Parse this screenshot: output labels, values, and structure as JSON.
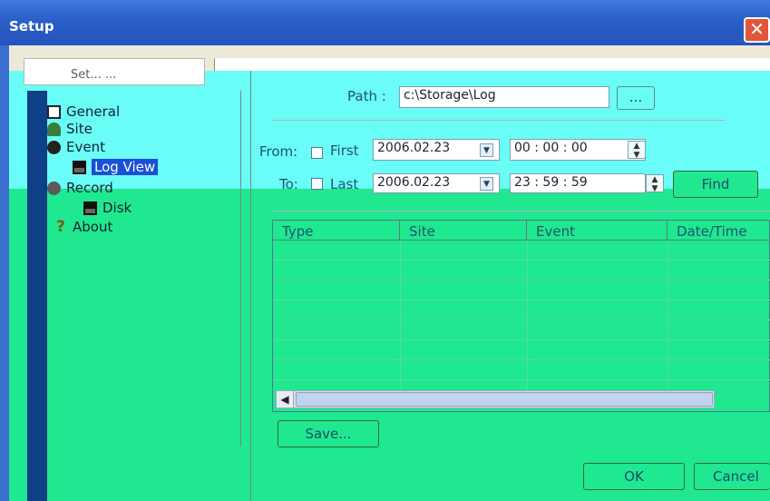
{
  "window": {
    "title": "Setup",
    "close_label": "✕"
  },
  "tab": {
    "label": "Set... ..."
  },
  "tree": {
    "items": [
      {
        "label": "General",
        "icon": "general-icon"
      },
      {
        "label": "Site",
        "icon": "site-icon"
      },
      {
        "label": "Event",
        "icon": "event-icon"
      },
      {
        "label": "Log View",
        "icon": "disk-icon",
        "selected": true
      },
      {
        "label": "Record",
        "icon": "record-icon"
      },
      {
        "label": "Disk",
        "icon": "disk-icon"
      },
      {
        "label": "About",
        "icon": "about-icon"
      }
    ]
  },
  "log": {
    "path_label": "Path :",
    "path_value": "c:\\Storage\\Log",
    "browse_label": "...",
    "from_label": "From:",
    "from_check_label": "First",
    "from_date": "2006.02.23",
    "from_time": "00 : 00 : 00",
    "to_label": "To:",
    "to_check_label": "Last",
    "to_date": "2006.02.23",
    "to_time": "23 : 59 : 59",
    "find_label": "Find",
    "columns": [
      "Type",
      "Site",
      "Event",
      "Date/Time"
    ],
    "save_label": "Save..."
  },
  "footer": {
    "ok_label": "OK",
    "cancel_label": "Cancel"
  },
  "colors": {
    "title_bar": "#2a5ec8",
    "selection": "#1a4fd8",
    "tint_cyan": "#6afcf6",
    "tint_green": "#1fe890"
  }
}
